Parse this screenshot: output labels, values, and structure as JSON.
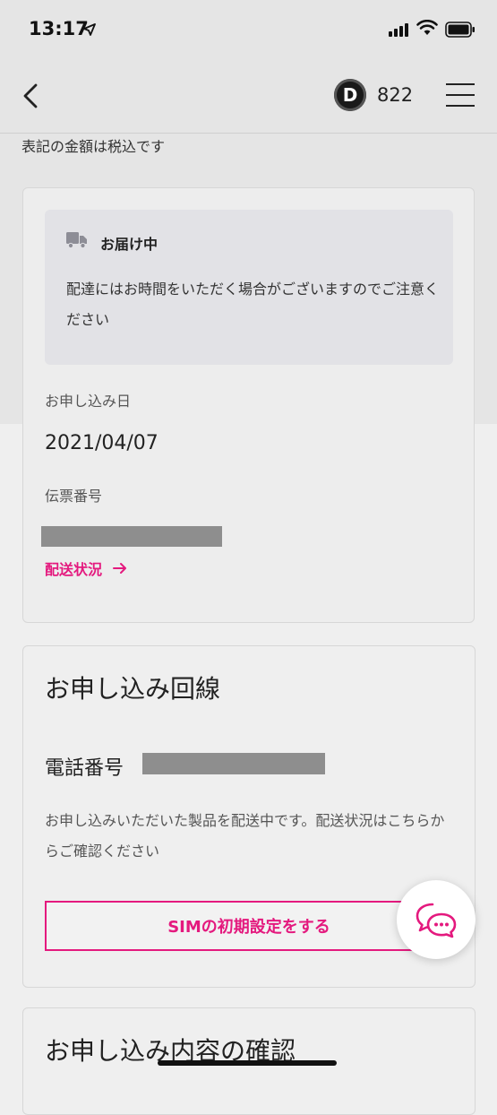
{
  "status_bar": {
    "time": "13:17"
  },
  "header": {
    "points_badge": "D",
    "points_value": "822"
  },
  "tax_note": "表記の金額は税込です",
  "delivery_card": {
    "notice_title": "お届け中",
    "notice_body": "配達にはお時間をいただく場合がございますのでご注意ください",
    "application_date_label": "お申し込み日",
    "application_date": "2021/04/07",
    "tracking_number_label": "伝票番号",
    "tracking_link": "配送状況"
  },
  "line_card": {
    "title": "お申し込み回線",
    "phone_label": "電話番号",
    "description": "お申し込みいただいた製品を配送中です。配送状況はこちらからご確認ください",
    "sim_button": "SIMの初期設定をする"
  },
  "confirm_card": {
    "title": "お申し込み内容の確認"
  },
  "colors": {
    "accent": "#e4197e",
    "background": "#efefef",
    "notice_bg": "#e2e2e6"
  },
  "icons": [
    "location-arrow-icon",
    "signal-icon",
    "wifi-icon",
    "battery-icon",
    "back-chevron-icon",
    "menu-icon",
    "truck-icon",
    "arrow-right-icon",
    "chat-icon"
  ]
}
